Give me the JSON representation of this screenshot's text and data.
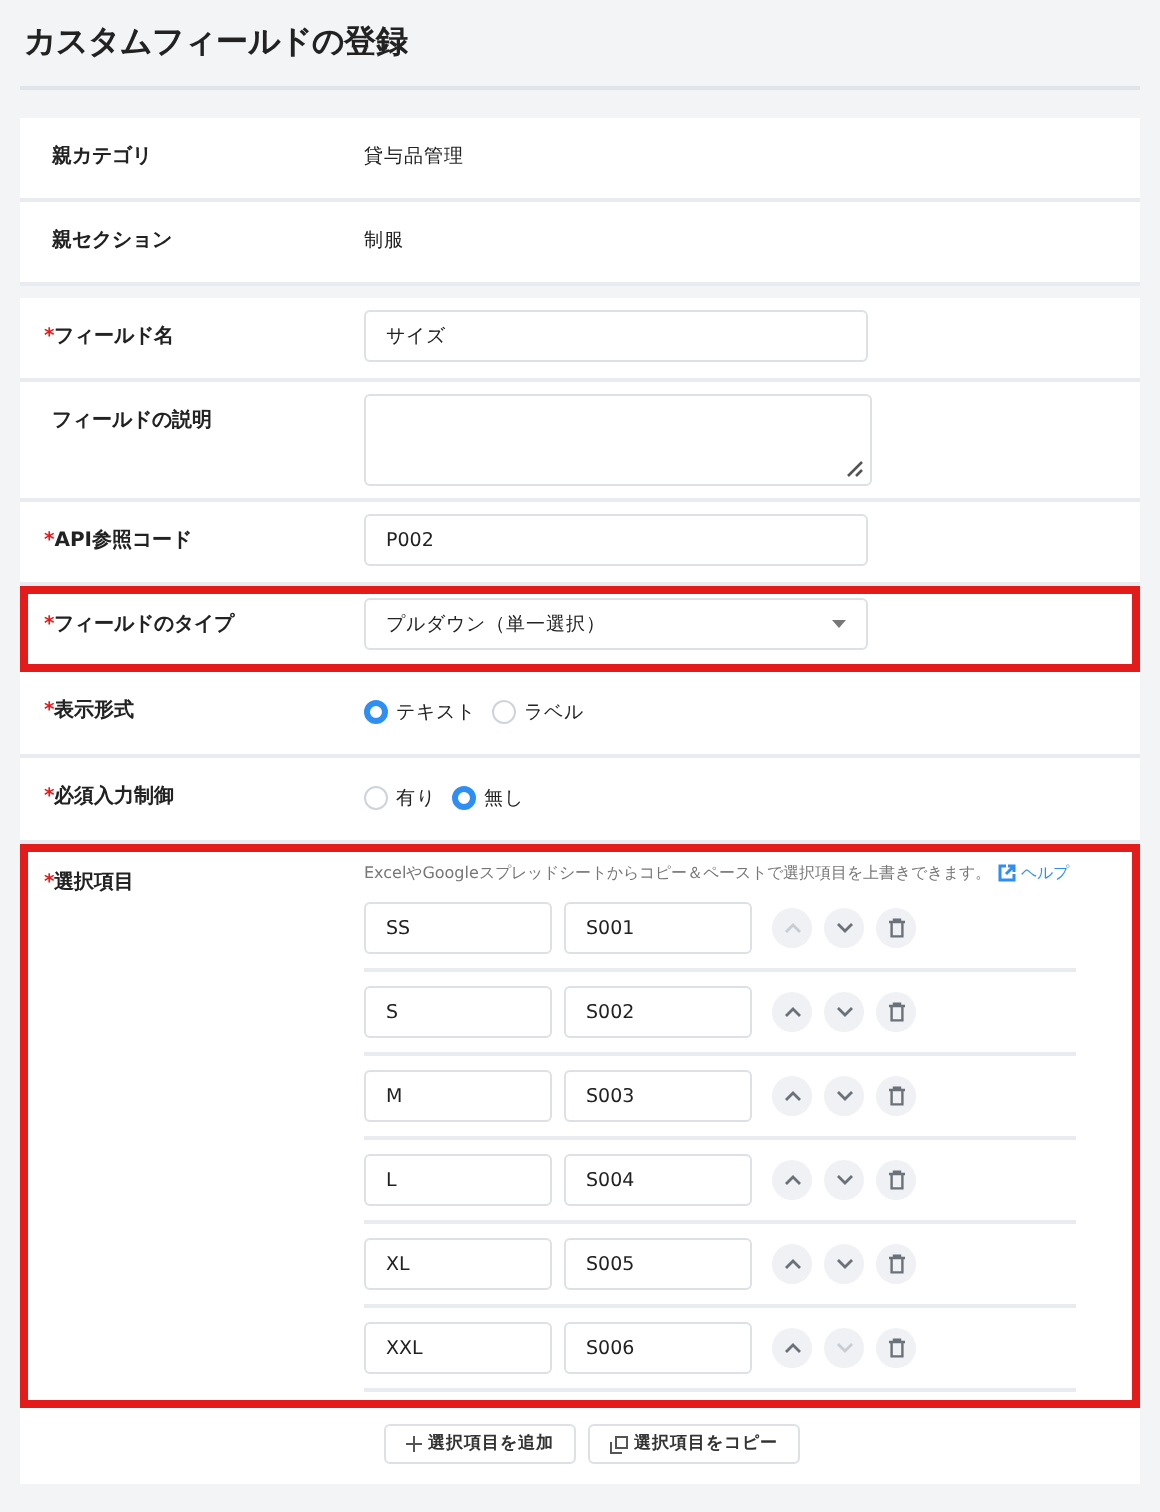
{
  "title": "カスタムフィールドの登録",
  "info_rows": [
    {
      "label": "親カテゴリ",
      "value": "貸与品管理"
    },
    {
      "label": "親セクション",
      "value": "制服"
    }
  ],
  "fields": [
    {
      "kind": "input",
      "required_mark": "*",
      "label": "フィールド名",
      "highlighted": false,
      "value": "サイズ"
    },
    {
      "kind": "textarea",
      "label": "フィールドの説明",
      "highlighted": false
    },
    {
      "kind": "input",
      "required_mark": "*",
      "label": "API参照コード",
      "highlighted": false,
      "value": "P002"
    },
    {
      "kind": "select",
      "required_mark": "*",
      "label": "フィールドのタイプ",
      "highlighted": true,
      "value": "プルダウン（単一選択）"
    },
    {
      "kind": "radio",
      "required_mark": "*",
      "label": "表示形式",
      "highlighted": false,
      "options": [
        {
          "label": "テキスト",
          "selected": true
        },
        {
          "label": "ラベル",
          "selected": false
        }
      ]
    },
    {
      "kind": "radio",
      "required_mark": "*",
      "label": "必須入力制御",
      "highlighted": false,
      "options": [
        {
          "label": "有り",
          "selected": false
        },
        {
          "label": "無し",
          "selected": true
        }
      ]
    },
    {
      "kind": "options",
      "required_mark": "*",
      "label": "選択項目",
      "highlighted": true,
      "hint": "ExcelやGoogleスプレッドシートからコピー＆ペーストで選択項目を上書きできます。",
      "help_link": "ヘルプ",
      "items": [
        {
          "name": "SS",
          "code": "S001",
          "up_disabled": true,
          "down_disabled": false
        },
        {
          "name": "S",
          "code": "S002",
          "up_disabled": false,
          "down_disabled": false
        },
        {
          "name": "M",
          "code": "S003",
          "up_disabled": false,
          "down_disabled": false
        },
        {
          "name": "L",
          "code": "S004",
          "up_disabled": false,
          "down_disabled": false
        },
        {
          "name": "XL",
          "code": "S005",
          "up_disabled": false,
          "down_disabled": false
        },
        {
          "name": "XXL",
          "code": "S006",
          "up_disabled": false,
          "down_disabled": true
        }
      ],
      "buttons": [
        {
          "kind": "add",
          "label": "選択項目を追加"
        },
        {
          "kind": "copy",
          "label": "選択項目をコピー"
        }
      ]
    }
  ]
}
